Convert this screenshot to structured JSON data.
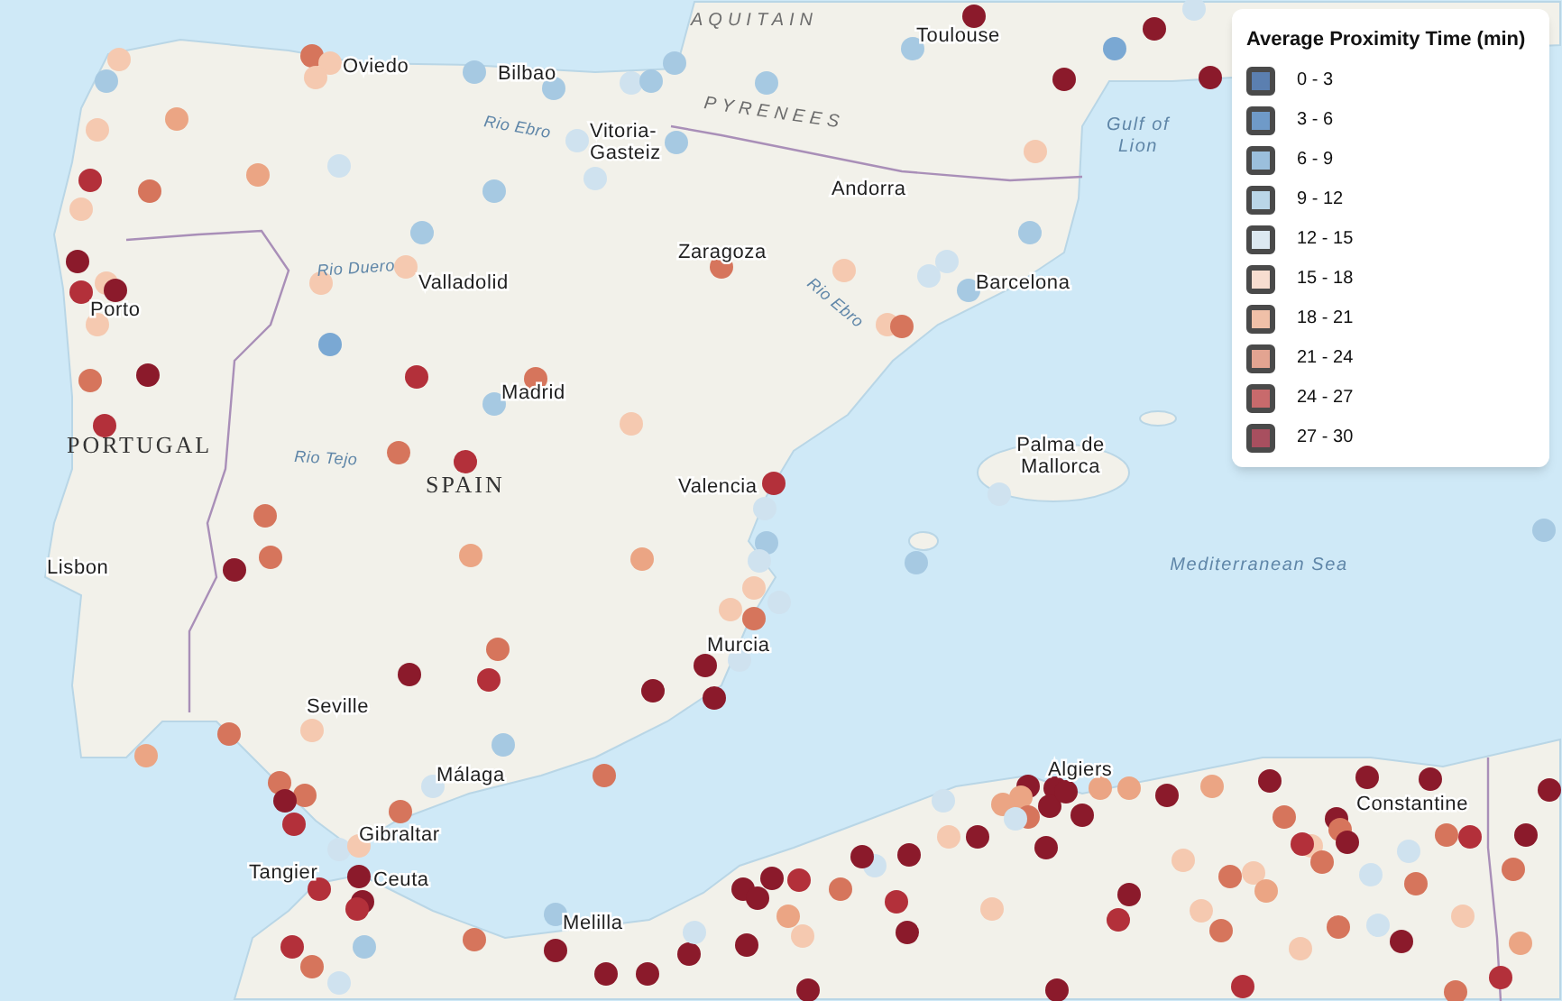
{
  "map": {
    "labels": [
      {
        "kind": "region",
        "lines": [
          "AQUITAIN"
        ]
      },
      {
        "kind": "city",
        "lines": [
          "Toulouse"
        ]
      },
      {
        "kind": "city",
        "lines": [
          "Oviedo"
        ]
      },
      {
        "kind": "city",
        "lines": [
          "Bilbao"
        ]
      },
      {
        "kind": "region",
        "lines": [
          "PYRENEES"
        ]
      },
      {
        "kind": "city",
        "lines": [
          "Vitoria-",
          "Gasteiz"
        ]
      },
      {
        "kind": "water",
        "lines": [
          "Gulf of",
          "Lion"
        ]
      },
      {
        "kind": "river",
        "lines": [
          "Rio Ebro"
        ]
      },
      {
        "kind": "city",
        "lines": [
          "Andorra"
        ]
      },
      {
        "kind": "city",
        "lines": [
          "Zaragoza"
        ]
      },
      {
        "kind": "river",
        "lines": [
          "Rio Duero"
        ]
      },
      {
        "kind": "city",
        "lines": [
          "Valladolid"
        ]
      },
      {
        "kind": "city",
        "lines": [
          "Barcelona"
        ]
      },
      {
        "kind": "river",
        "lines": [
          "Rio Ebro"
        ]
      },
      {
        "kind": "city",
        "lines": [
          "Porto"
        ]
      },
      {
        "kind": "city",
        "lines": [
          "Madrid"
        ]
      },
      {
        "kind": "country",
        "lines": [
          "PORTUGAL"
        ]
      },
      {
        "kind": "city",
        "lines": [
          "Palma de",
          "Mallorca"
        ]
      },
      {
        "kind": "river",
        "lines": [
          "Rio Tejo"
        ]
      },
      {
        "kind": "country",
        "lines": [
          "SPAIN"
        ]
      },
      {
        "kind": "city",
        "lines": [
          "Valencia"
        ]
      },
      {
        "kind": "city",
        "lines": [
          "Lisbon"
        ]
      },
      {
        "kind": "water",
        "lines": [
          "Mediterranean Sea"
        ]
      },
      {
        "kind": "city",
        "lines": [
          "Murcia"
        ]
      },
      {
        "kind": "city",
        "lines": [
          "Seville"
        ]
      },
      {
        "kind": "city",
        "lines": [
          "Málaga"
        ]
      },
      {
        "kind": "city",
        "lines": [
          "Gibraltar"
        ]
      },
      {
        "kind": "city",
        "lines": [
          "Algiers"
        ]
      },
      {
        "kind": "city",
        "lines": [
          "Constantine"
        ]
      },
      {
        "kind": "city",
        "lines": [
          "Tangier"
        ]
      },
      {
        "kind": "city",
        "lines": [
          "Ceuta"
        ]
      },
      {
        "kind": "city",
        "lines": [
          "Melilla"
        ]
      }
    ],
    "markers": [
      {
        "color": "#f5c9b0"
      },
      {
        "color": "#a6c9e2"
      },
      {
        "color": "#eba584"
      },
      {
        "color": "#f5c9b0"
      },
      {
        "color": "#b3303a"
      },
      {
        "color": "#d6755c"
      },
      {
        "color": "#eba584"
      },
      {
        "color": "#f5c9b0"
      },
      {
        "color": "#cfe2ef"
      },
      {
        "color": "#d6755c"
      },
      {
        "color": "#f5c9b0"
      },
      {
        "color": "#f5c9b0"
      },
      {
        "color": "#a6c9e2"
      },
      {
        "color": "#a6c9e2"
      },
      {
        "color": "#cfe2ef"
      },
      {
        "color": "#a6c9e2"
      },
      {
        "color": "#a6c9e2"
      },
      {
        "color": "#cfe2ef"
      },
      {
        "color": "#a6c9e2"
      },
      {
        "color": "#cfe2ef"
      },
      {
        "color": "#a6c9e2"
      },
      {
        "color": "#a6c9e2"
      },
      {
        "color": "#a6c9e2"
      },
      {
        "color": "#8b1a2b"
      },
      {
        "color": "#f5c9b0"
      },
      {
        "color": "#b3303a"
      },
      {
        "color": "#8b1a2b"
      },
      {
        "color": "#f5c9b0"
      },
      {
        "color": "#f5c9b0"
      },
      {
        "color": "#f5c9b0"
      },
      {
        "color": "#7aa8d3"
      },
      {
        "color": "#d6755c"
      },
      {
        "color": "#8b1a2b"
      },
      {
        "color": "#b3303a"
      },
      {
        "color": "#b3303a"
      },
      {
        "color": "#d6755c"
      },
      {
        "color": "#a6c9e2"
      },
      {
        "color": "#f5c9b0"
      },
      {
        "color": "#d6755c"
      },
      {
        "color": "#b3303a"
      },
      {
        "color": "#b3303a"
      },
      {
        "color": "#8b1a2b"
      },
      {
        "color": "#a6c9e2"
      },
      {
        "color": "#8b1a2b"
      },
      {
        "color": "#7aa8d3"
      },
      {
        "color": "#8b1a2b"
      },
      {
        "color": "#cfe2ef"
      },
      {
        "color": "#8b1a2b"
      },
      {
        "color": "#f5c9b0"
      },
      {
        "color": "#a6c9e2"
      },
      {
        "color": "#d6755c"
      },
      {
        "color": "#f5c9b0"
      },
      {
        "color": "#cfe2ef"
      },
      {
        "color": "#cfe2ef"
      },
      {
        "color": "#a6c9e2"
      },
      {
        "color": "#f5c9b0"
      },
      {
        "color": "#d6755c"
      },
      {
        "color": "#cfe2ef"
      },
      {
        "color": "#d6755c"
      },
      {
        "color": "#d6755c"
      },
      {
        "color": "#8b1a2b"
      },
      {
        "color": "#eba584"
      },
      {
        "color": "#eba584"
      },
      {
        "color": "#a6c9e2"
      },
      {
        "color": "#cfe2ef"
      },
      {
        "color": "#f5c9b0"
      },
      {
        "color": "#f5c9b0"
      },
      {
        "color": "#d6755c"
      },
      {
        "color": "#cfe2ef"
      },
      {
        "color": "#8b1a2b"
      },
      {
        "color": "#cfe2ef"
      },
      {
        "color": "#8b1a2b"
      },
      {
        "color": "#8b1a2b"
      },
      {
        "color": "#d6755c"
      },
      {
        "color": "#8b1a2b"
      },
      {
        "color": "#b3303a"
      },
      {
        "color": "#a6c9e2"
      },
      {
        "color": "#d6755c"
      },
      {
        "color": "#cfe2ef"
      },
      {
        "color": "#d6755c"
      },
      {
        "color": "#f5c9b0"
      },
      {
        "color": "#d6755c"
      },
      {
        "color": "#eba584"
      },
      {
        "color": "#d6755c"
      },
      {
        "color": "#d6755c"
      },
      {
        "color": "#8b1a2b"
      },
      {
        "color": "#b3303a"
      },
      {
        "color": "#cfe2ef"
      },
      {
        "color": "#f5c9b0"
      },
      {
        "color": "#8b1a2b"
      },
      {
        "color": "#8b1a2b"
      },
      {
        "color": "#b3303a"
      },
      {
        "color": "#b3303a"
      },
      {
        "color": "#a6c9e2"
      },
      {
        "color": "#b3303a"
      },
      {
        "color": "#d6755c"
      },
      {
        "color": "#cfe2ef"
      },
      {
        "color": "#d6755c"
      },
      {
        "color": "#8b1a2b"
      },
      {
        "color": "#a6c9e2"
      },
      {
        "color": "#a6c9e2"
      },
      {
        "color": "#cfe2ef"
      },
      {
        "color": "#a6c9e2"
      },
      {
        "color": "#8b1a2b"
      },
      {
        "color": "#8b1a2b"
      },
      {
        "color": "#8b1a2b"
      },
      {
        "color": "#b3303a"
      },
      {
        "color": "#8b1a2b"
      },
      {
        "color": "#8b1a2b"
      },
      {
        "color": "#8b1a2b"
      },
      {
        "color": "#cfe2ef"
      },
      {
        "color": "#8b1a2b"
      },
      {
        "color": "#eba584"
      },
      {
        "color": "#f5c9b0"
      },
      {
        "color": "#d6755c"
      },
      {
        "color": "#cfe2ef"
      },
      {
        "color": "#8b1a2b"
      },
      {
        "color": "#8b1a2b"
      },
      {
        "color": "#b3303a"
      },
      {
        "color": "#f5c9b0"
      },
      {
        "color": "#f5c9b0"
      },
      {
        "color": "#8b1a2b"
      },
      {
        "color": "#8b1a2b"
      },
      {
        "color": "#8b1a2b"
      },
      {
        "color": "#8b1a2b"
      },
      {
        "color": "#eba584"
      },
      {
        "color": "#8b1a2b"
      },
      {
        "color": "#eba584"
      },
      {
        "color": "#d6755c"
      },
      {
        "color": "#8b1a2b"
      },
      {
        "color": "#8b1a2b"
      },
      {
        "color": "#cfe2ef"
      },
      {
        "color": "#eba584"
      },
      {
        "color": "#eba584"
      },
      {
        "color": "#eba584"
      },
      {
        "color": "#8b1a2b"
      },
      {
        "color": "#8b1a2b"
      },
      {
        "color": "#8b1a2b"
      },
      {
        "color": "#8b1a2b"
      },
      {
        "color": "#d6755c"
      },
      {
        "color": "#8b1a2b"
      },
      {
        "color": "#f5c9b0"
      },
      {
        "color": "#b3303a"
      },
      {
        "color": "#f5c9b0"
      },
      {
        "color": "#d6755c"
      },
      {
        "color": "#d6755c"
      },
      {
        "color": "#d6755c"
      },
      {
        "color": "#cfe2ef"
      },
      {
        "color": "#cfe2ef"
      },
      {
        "color": "#d6755c"
      },
      {
        "color": "#b3303a"
      },
      {
        "color": "#d6755c"
      },
      {
        "color": "#8b1a2b"
      },
      {
        "color": "#d6755c"
      },
      {
        "color": "#8b1a2b"
      },
      {
        "color": "#8b1a2b"
      },
      {
        "color": "#f5c9b0"
      },
      {
        "color": "#b3303a"
      },
      {
        "color": "#f5c9b0"
      },
      {
        "color": "#8b1a2b"
      },
      {
        "color": "#8b1a2b"
      },
      {
        "color": "#cfe2ef"
      },
      {
        "color": "#8b1a2b"
      },
      {
        "color": "#eba584"
      },
      {
        "color": "#f5c9b0"
      },
      {
        "color": "#d6755c"
      },
      {
        "color": "#d6755c"
      },
      {
        "color": "#cfe2ef"
      },
      {
        "color": "#f5c9b0"
      },
      {
        "color": "#d6755c"
      },
      {
        "color": "#eba584"
      },
      {
        "color": "#b3303a"
      },
      {
        "color": "#8b1a2b"
      },
      {
        "color": "#b3303a"
      },
      {
        "color": "#8b1a2b"
      }
    ]
  },
  "legend": {
    "title": "Average Proximity Time (min)",
    "items": [
      {
        "label": "0 - 3",
        "color": "#5b7fb0"
      },
      {
        "label": "3 - 6",
        "color": "#6f9ac8"
      },
      {
        "label": "6 - 9",
        "color": "#9bbfdc"
      },
      {
        "label": "9 - 12",
        "color": "#bad6e8"
      },
      {
        "label": "12 - 15",
        "color": "#dce8f0"
      },
      {
        "label": "15 - 18",
        "color": "#f7ddd0"
      },
      {
        "label": "18 - 21",
        "color": "#f0c0a8"
      },
      {
        "label": "21 - 24",
        "color": "#e3a491"
      },
      {
        "label": "24 - 27",
        "color": "#c86a6c"
      },
      {
        "label": "27 - 30",
        "color": "#a84f5f"
      }
    ]
  }
}
